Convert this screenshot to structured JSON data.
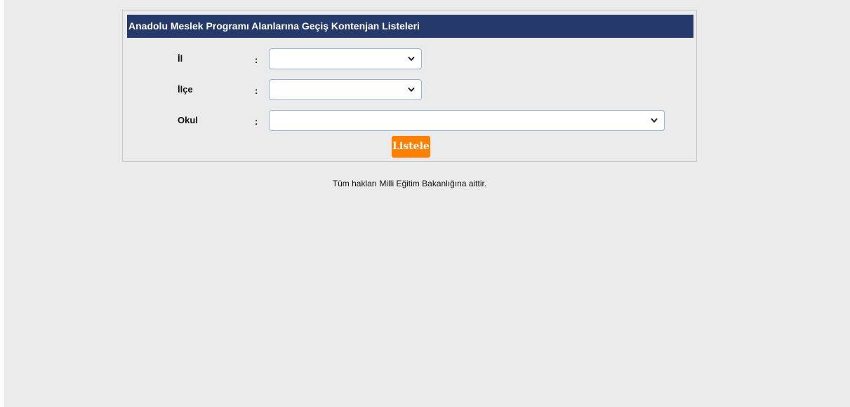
{
  "panel": {
    "title": "Anadolu Meslek Programı Alanlarına Geçiş Kontenjan Listeleri"
  },
  "form": {
    "fields": [
      {
        "label": "İl",
        "separator": ":",
        "value": ""
      },
      {
        "label": "İlçe",
        "separator": ":",
        "value": ""
      },
      {
        "label": "Okul",
        "separator": ":",
        "value": ""
      }
    ],
    "submit_label": "Listele"
  },
  "footer": {
    "text": "Tüm hakları Milli Eğitim Bakanlığına aittir."
  },
  "colors": {
    "header_bg": "#25396a",
    "button_bg": "#ff7f00",
    "page_bg": "#ebebeb",
    "select_border": "#8fb4d6"
  },
  "icons": {
    "dropdown": "chevron-down-icon"
  }
}
